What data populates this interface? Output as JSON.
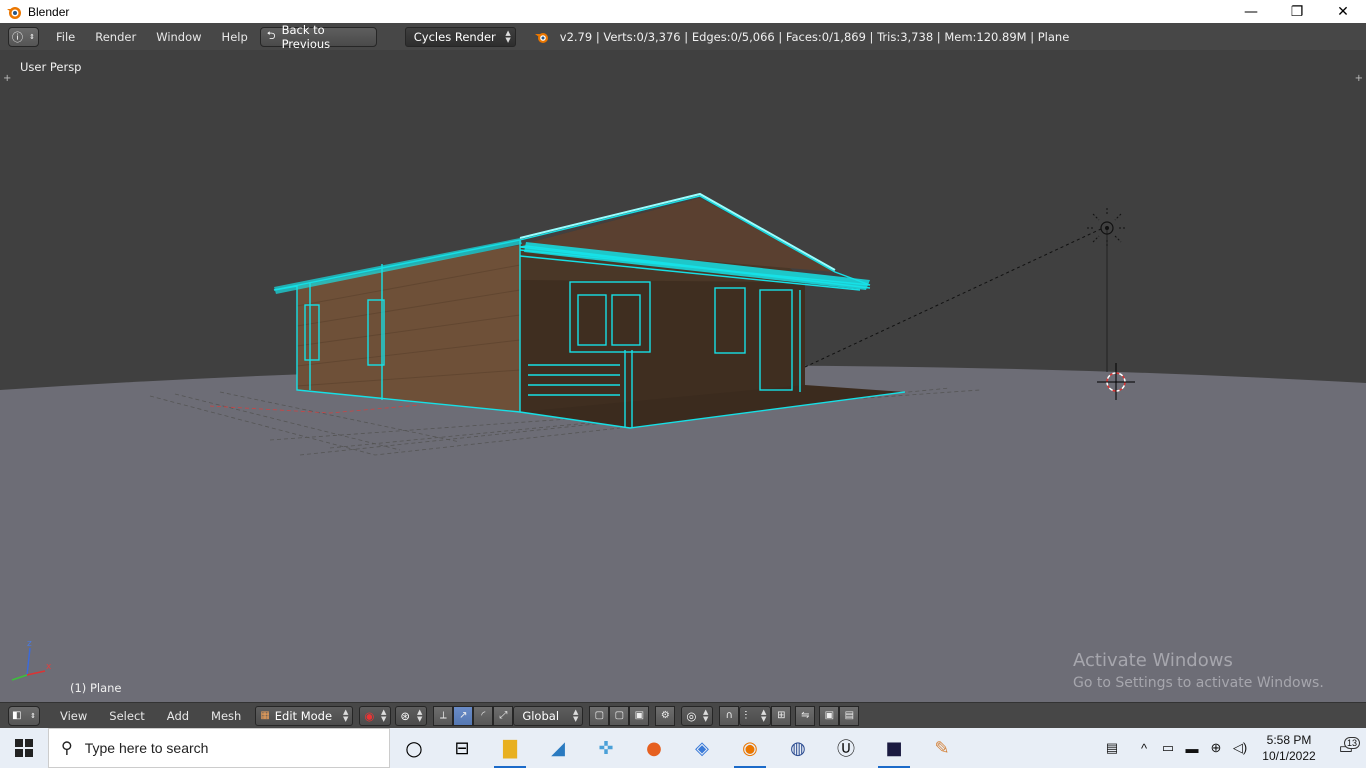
{
  "window": {
    "title": "Blender",
    "controls": {
      "minimize": "—",
      "restore": "❐",
      "close": "✕"
    }
  },
  "info_header": {
    "menus": [
      "File",
      "Render",
      "Window",
      "Help"
    ],
    "back_button": "Back to Previous",
    "render_engine": "Cycles Render",
    "stats": "v2.79 | Verts:0/3,376 | Edges:0/5,066 | Faces:0/1,869 | Tris:3,738 | Mem:120.89M | Plane"
  },
  "viewport": {
    "view_label": "User Persp",
    "object_label": "(1) Plane",
    "axis": {
      "z": "z",
      "x": "x"
    },
    "watermark": {
      "title": "Activate Windows",
      "subtitle": "Go to Settings to activate Windows."
    },
    "colors": {
      "background": "#404040",
      "ground": "#6d6d76",
      "wire_selected": "#16e0e6",
      "wall": "#7a5a3f"
    }
  },
  "view3d_header": {
    "menus": [
      "View",
      "Select",
      "Add",
      "Mesh"
    ],
    "mode": "Edit Mode",
    "orientation": "Global"
  },
  "taskbar": {
    "search_placeholder": "Type here to search",
    "time": "5:58 PM",
    "date": "10/1/2022",
    "notification_count": "13",
    "apps": [
      "task-view-icon",
      "file-explorer-icon",
      "dolphin-emulator-icon",
      "game-controller-icon",
      "firefox-icon",
      "app-icon",
      "blender-icon",
      "media-player-icon",
      "unreal-engine-icon",
      "game-launcher-icon",
      "paint-icon"
    ]
  }
}
